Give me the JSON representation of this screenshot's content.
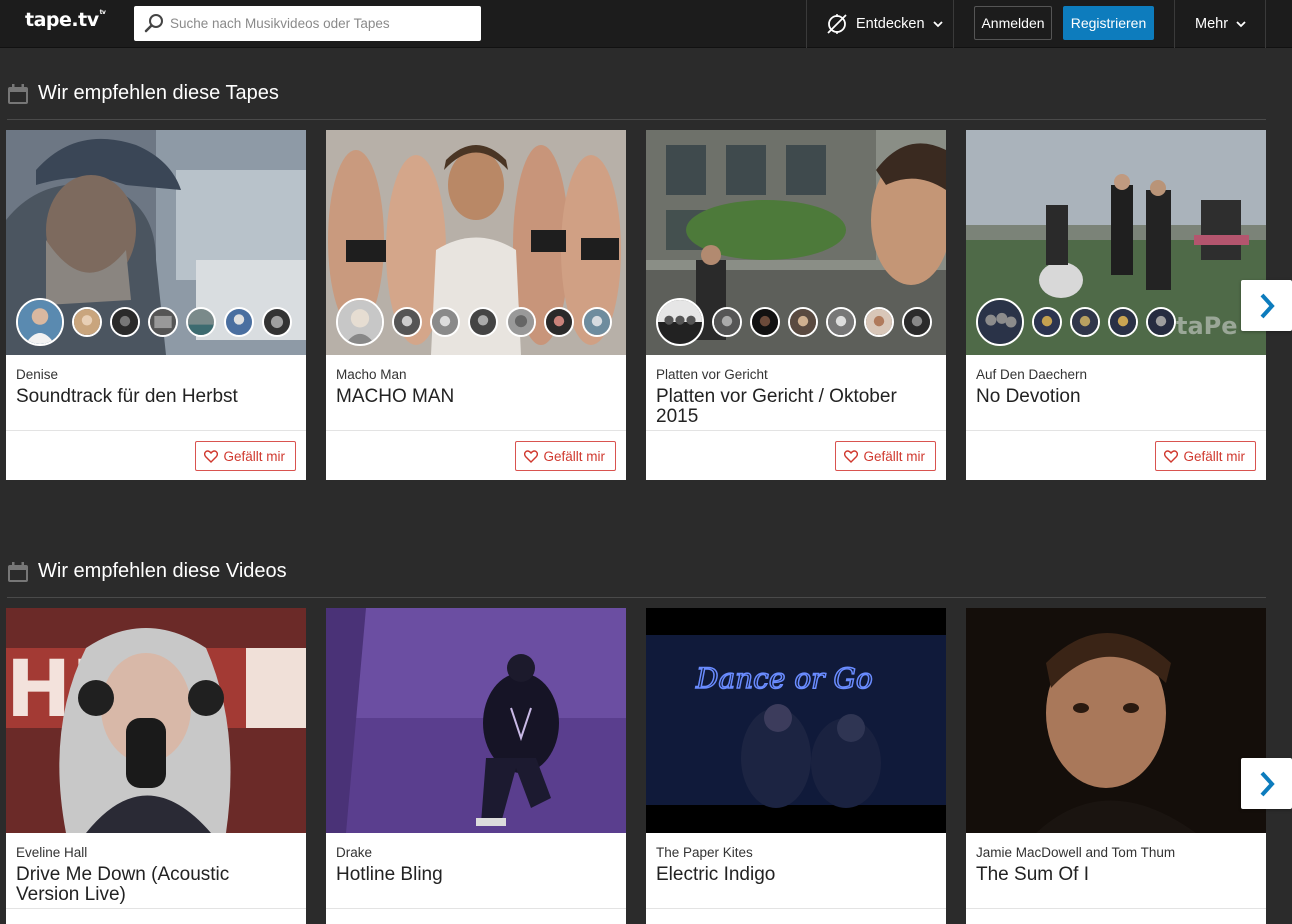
{
  "header": {
    "logo": "tape.tv",
    "logo_mark": "tv",
    "search_placeholder": "Suche nach Musikvideos oder Tapes",
    "explore_label": "Entdecken",
    "login_label": "Anmelden",
    "register_label": "Registrieren",
    "more_label": "Mehr"
  },
  "tapes_section": {
    "title": "Wir empfehlen diese Tapes",
    "items": [
      {
        "artist": "Denise",
        "title": "Soundtrack für den Herbst",
        "like_label": "Gefällt mir"
      },
      {
        "artist": "Macho Man",
        "title": "MACHO MAN",
        "like_label": "Gefällt mir"
      },
      {
        "artist": "Platten vor Gericht",
        "title": "Platten vor Gericht / Oktober 2015",
        "like_label": "Gefällt mir"
      },
      {
        "artist": "Auf Den Daechern",
        "title": "No Devotion",
        "like_label": "Gefällt mir"
      }
    ]
  },
  "videos_section": {
    "title": "Wir empfehlen diese Videos",
    "items": [
      {
        "artist": "Eveline Hall",
        "title": "Drive Me Down (Acoustic Version Live)"
      },
      {
        "artist": "Drake",
        "title": "Hotline Bling"
      },
      {
        "artist": "The Paper Kites",
        "title": "Electric Indigo"
      },
      {
        "artist": "Jamie MacDowell and Tom Thum",
        "title": "The Sum Of I"
      }
    ]
  },
  "thumb_text": {
    "neon_sign": "Dance or Go",
    "hmm_sign": "HM",
    "tape_logo": "taPe"
  },
  "colors": {
    "accent_blue": "#0d7cbd",
    "like_red": "#d0392f",
    "page_bg": "#2b2b2b",
    "topbar_bg": "#1c1c1c"
  }
}
